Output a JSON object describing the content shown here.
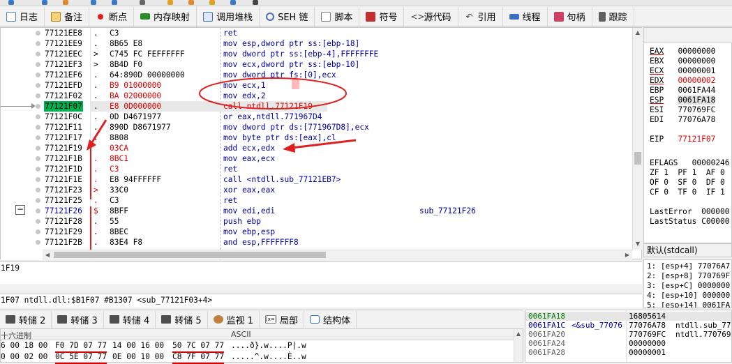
{
  "toolbar_tabs": [
    {
      "label": "日志",
      "icon": "log-icon"
    },
    {
      "label": "备注",
      "icon": "notes-icon"
    },
    {
      "label": "断点",
      "icon": "breakpoint-icon"
    },
    {
      "label": "内存映射",
      "icon": "memory-map-icon"
    },
    {
      "label": "调用堆栈",
      "icon": "call-stack-icon"
    },
    {
      "label": "SEH 链",
      "icon": "seh-chain-icon"
    },
    {
      "label": "脚本",
      "icon": "script-icon"
    },
    {
      "label": "符号",
      "icon": "symbols-icon"
    },
    {
      "label": "源代码",
      "icon": "source-icon"
    },
    {
      "label": "引用",
      "icon": "references-icon"
    },
    {
      "label": "线程",
      "icon": "threads-icon"
    },
    {
      "label": "句柄",
      "icon": "handles-icon"
    },
    {
      "label": "跟踪",
      "icon": "trace-icon"
    }
  ],
  "disasm": {
    "rows": [
      {
        "addr": "77121EE8",
        "mark": ".",
        "bytes": "C3",
        "instr": "ret",
        "comment": ""
      },
      {
        "addr": "77121EE9",
        "mark": ".",
        "bytes": "8B65 E8",
        "instr": "mov esp,dword ptr ss:[ebp-18]",
        "comment": ""
      },
      {
        "addr": "77121EEC",
        "mark": ">",
        "bytes": "C745 FC FEFFFFFF",
        "instr": "mov dword ptr ss:[ebp-4],FFFFFFFE",
        "comment": ""
      },
      {
        "addr": "77121EF3",
        "mark": ">",
        "bytes": "8B4D F0",
        "instr": "mov ecx,dword ptr ss:[ebp-10]",
        "comment": ""
      },
      {
        "addr": "77121EF6",
        "mark": ".",
        "bytes": "64:890D 00000000",
        "instr": "mov dword ptr fs:[0],ecx",
        "comment": ""
      },
      {
        "addr": "77121EFD",
        "mark": ".",
        "bytes": "B9 01000000",
        "instr": "mov ecx,1",
        "comment": ""
      },
      {
        "addr": "77121F02",
        "mark": ".",
        "bytes": "BA 02000000",
        "instr": "mov edx,2",
        "comment": ""
      },
      {
        "addr": "77121F07",
        "mark": ".",
        "bytes": "E8 0D000000",
        "instr": "call ntdll.77121F19",
        "comment": ""
      },
      {
        "addr": "77121F0C",
        "mark": ".",
        "bytes": "0D D4671977",
        "instr": "or eax,ntdll.771967D4",
        "comment": ""
      },
      {
        "addr": "77121F11",
        "mark": ".",
        "bytes": "890D D8671977",
        "instr": "mov dword ptr ds:[771967D8],ecx",
        "comment": ""
      },
      {
        "addr": "77121F17",
        "mark": ".",
        "bytes": "8808",
        "instr": "mov byte ptr ds:[eax],cl",
        "comment": ""
      },
      {
        "addr": "77121F19",
        "mark": "",
        "bytes": "03CA",
        "instr": "add ecx,edx",
        "comment": ""
      },
      {
        "addr": "77121F1B",
        "mark": ".",
        "bytes": "8BC1",
        "instr": "mov eax,ecx",
        "comment": ""
      },
      {
        "addr": "77121F1D",
        "mark": ".",
        "bytes": "C3",
        "instr": "ret",
        "comment": ""
      },
      {
        "addr": "77121F1E",
        "mark": ".",
        "bytes": "E8 94FFFFFF",
        "instr": "call <ntdll.sub_77121EB7>",
        "comment": ""
      },
      {
        "addr": "77121F23",
        "mark": ">",
        "bytes": "33C0",
        "instr": "xor eax,eax",
        "comment": ""
      },
      {
        "addr": "77121F25",
        "mark": ".",
        "bytes": "C3",
        "instr": "ret",
        "comment": ""
      },
      {
        "addr": "77121F26",
        "mark": "$",
        "bytes": "8BFF",
        "instr": "mov edi,edi",
        "comment": "sub_77121F26"
      },
      {
        "addr": "77121F28",
        "mark": ".",
        "bytes": "55",
        "instr": "push ebp",
        "comment": ""
      },
      {
        "addr": "77121F29",
        "mark": ".",
        "bytes": "8BEC",
        "instr": "mov ebp,esp",
        "comment": ""
      },
      {
        "addr": "77121F2B",
        "mark": ".",
        "bytes": "83E4 F8",
        "instr": "and esp,FFFFFFF8",
        "comment": ""
      }
    ],
    "collapse_button": "−"
  },
  "registers": {
    "lines": [
      {
        "name": "EAX",
        "value": "00000000"
      },
      {
        "name": "EBX",
        "value": "00000000"
      },
      {
        "name": "ECX",
        "value": "00000001"
      },
      {
        "name": "EDX",
        "value": "00000002"
      },
      {
        "name": "EBP",
        "value": "0061FA44"
      },
      {
        "name": "ESP",
        "value": "0061FA18"
      },
      {
        "name": "ESI",
        "value": "770769FC"
      },
      {
        "name": "EDI",
        "value": "77076A78"
      },
      {
        "name": "EIP",
        "value": "77121F07"
      }
    ],
    "eflags_label": "EFLAGS",
    "eflags_value": "00000246",
    "flags_row1": "ZF 1  PF 1  AF 0",
    "flags_row2": "OF 0  SF 0  DF 0",
    "flags_row3": "CF 0  TF 0  IF 1",
    "last_error": "LastError  000000",
    "last_status": "LastStatus C00000"
  },
  "call_convention": "默认(stdcall)",
  "stack_args": [
    "1: [esp+4] 77076A7",
    "2: [esp+8] 770769F",
    "3: [esp+C] 0000000",
    "4: [esp+10] 000000",
    "5: [esp+14] 0061FA"
  ],
  "info": {
    "line1": "1F19",
    "line2": "1F07 ntdll.dll:$B1F07 #B1307 <sub_77121F03+4>"
  },
  "dump_tabs": [
    {
      "label": "转储 2"
    },
    {
      "label": "转储 3"
    },
    {
      "label": "转储 4"
    },
    {
      "label": "转储 5"
    },
    {
      "label": "监视 1"
    },
    {
      "label": "局部",
      "icon_text": "[x=]"
    },
    {
      "label": "结构体"
    }
  ],
  "dump": {
    "hex_header": "十六进制",
    "ascii_header": "ASCII",
    "rows": [
      {
        "c0": "6 00 18 00",
        "c1": "F0 7D 07 77",
        "c2": "14 00 16 00",
        "c3": "50 7C 07 77",
        "ascii": "....ð}.w....P|.w"
      },
      {
        "c0": "0 00 02 00",
        "c1": "0C 5E 07 77",
        "c2": "0E 00 10 00",
        "c3": "C8 7F 07 77",
        "ascii": ".....^.w....È..w"
      }
    ]
  },
  "stack": {
    "rows": [
      {
        "addr": "0061FA18",
        "value": "16805614",
        "comment": ""
      },
      {
        "addr": "0061FA1C",
        "extra": "<&sub_77076",
        "value": "77076A78",
        "comment": "ntdll.sub_770"
      },
      {
        "addr": "0061FA20",
        "value": "770769FC",
        "comment": "ntdll.770769"
      },
      {
        "addr": "0061FA24",
        "value": "00000000",
        "comment": ""
      },
      {
        "addr": "0061FA28",
        "value": "00000001",
        "comment": ""
      }
    ]
  }
}
